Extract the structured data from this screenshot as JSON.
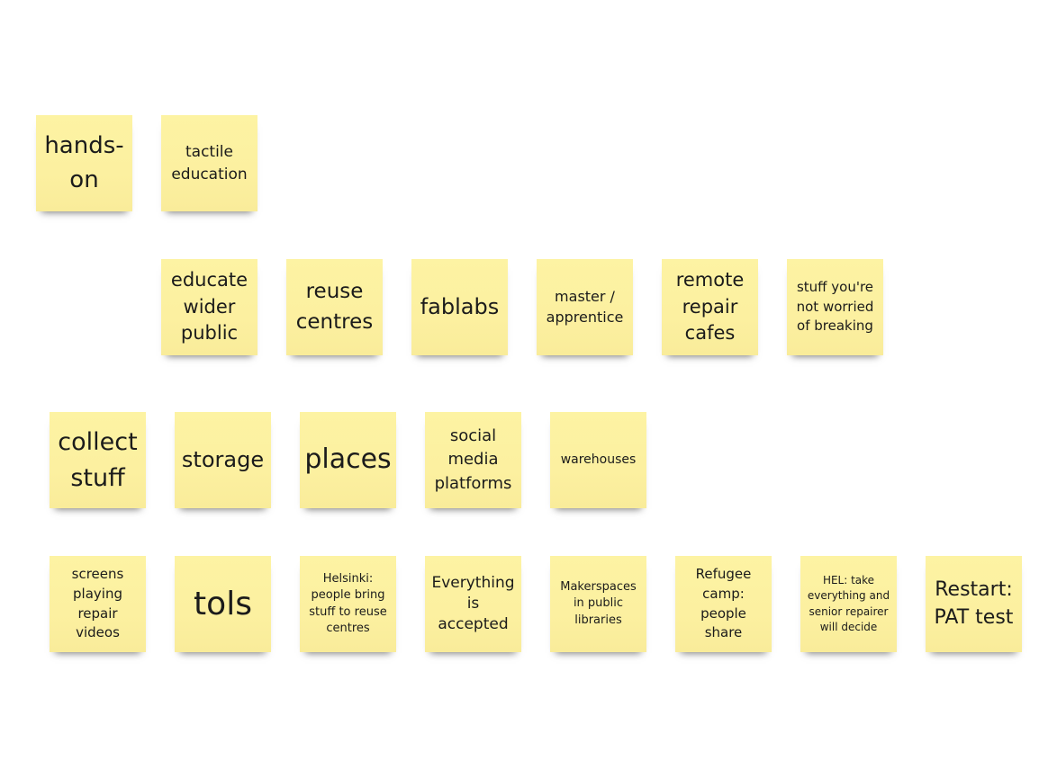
{
  "board": {
    "notes": [
      {
        "text": "hands-on"
      },
      {
        "text": "tactile education"
      },
      {
        "text": "educate wider public"
      },
      {
        "text": "reuse centres"
      },
      {
        "text": "fablabs"
      },
      {
        "text": "master / apprentice"
      },
      {
        "text": "remote repair cafes"
      },
      {
        "text": "stuff you're not worried of breaking"
      },
      {
        "text": "collect stuff"
      },
      {
        "text": "storage"
      },
      {
        "text": "places"
      },
      {
        "text": "social media platforms"
      },
      {
        "text": "warehouses"
      },
      {
        "text": "screens playing repair videos"
      },
      {
        "text": "tols"
      },
      {
        "text": "Helsinki: people bring stuff to reuse centres"
      },
      {
        "text": "Everything is accepted"
      },
      {
        "text": "Makerspaces in public libraries"
      },
      {
        "text": "Refugee camp: people share"
      },
      {
        "text": "HEL: take everything and senior repairer will decide"
      },
      {
        "text": "Restart: PAT test"
      }
    ],
    "note_color": "#fcf0a0"
  }
}
